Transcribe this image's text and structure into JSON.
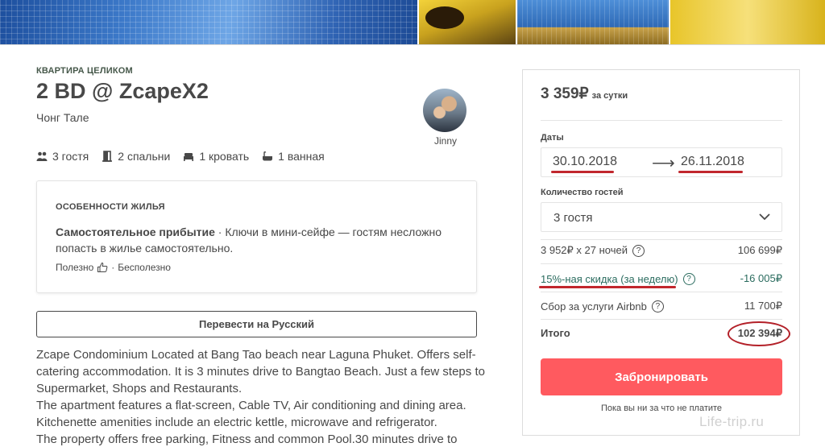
{
  "listing": {
    "type_label": "КВАРТИРА ЦЕЛИКОМ",
    "title": "2 BD @ ZcapeX2",
    "location": "Чонг Тале",
    "host_name": "Jinny",
    "amenities": [
      {
        "icon": "guests-icon",
        "label": "3 гостя"
      },
      {
        "icon": "bedroom-icon",
        "label": "2 спальни"
      },
      {
        "icon": "bed-icon",
        "label": "1 кровать"
      },
      {
        "icon": "bathtub-icon",
        "label": "1 ванная"
      }
    ]
  },
  "features": {
    "heading": "ОСОБЕННОСТИ ЖИЛЬЯ",
    "title": "Самостоятельное прибытие",
    "separator": " · ",
    "text": "Ключи в мини-сейфе — гостям несложно попасть в жилье самостоятельно.",
    "helpful": "Полезно",
    "middle_dot": "·",
    "not_helpful": "Бесполезно"
  },
  "translate_label": "Перевести на Русский",
  "description": [
    "Zcape Condominium Located at Bang Tao beach near Laguna Phuket. Offers self-catering accommodation. It is 3 minutes drive to Bangtao Beach. Just a few steps to Supermarket, Shops and Restaurants.",
    "The apartment features a flat-screen, Cable TV, Air conditioning and dining area. Kitchenette amenities include an electric kettle, microwave and refrigerator.",
    "The property offers free parking, Fitness and common Pool.30 minutes drive to"
  ],
  "booking": {
    "price": "3 359₽",
    "per_night": "за сутки",
    "dates_label": "Даты",
    "checkin": "30.10.2018",
    "arrow": "⟶",
    "checkout": "26.11.2018",
    "guests_label": "Количество гостей",
    "guests_value": "3 гостя",
    "nights_line": "3 952₽ x 27 ночей",
    "nights_total": "106 699₽",
    "discount_label": "15%-ная скидка (за неделю)",
    "discount_value": "-16 005₽",
    "fee_label": "Сбор за услуги Airbnb",
    "fee_value": "11 700₽",
    "total_label": "Итого",
    "total_value": "102 394₽",
    "help_mark": "?",
    "book_button": "Забронировать",
    "no_charge": "Пока вы ни за что не платите"
  },
  "watermark": "Life-trip.ru",
  "colors": {
    "text": "#484848",
    "accent_button": "#ff5a5f",
    "discount_green": "#2b6c5f",
    "annotation_red": "#c1272d"
  }
}
